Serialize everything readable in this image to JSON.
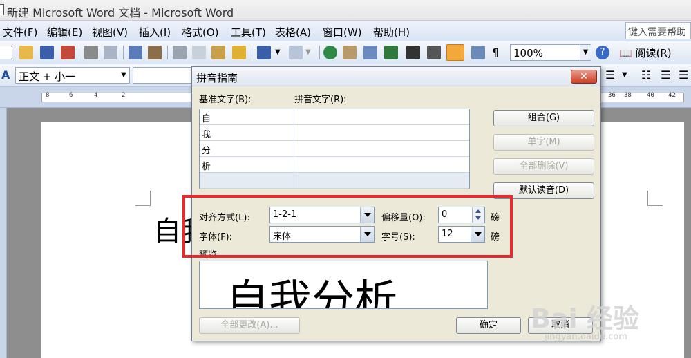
{
  "window": {
    "title": "新建 Microsoft Word 文档 - Microsoft Word"
  },
  "menubar": {
    "items": [
      "文件(F)",
      "编辑(E)",
      "视图(V)",
      "插入(I)",
      "格式(O)",
      "工具(T)",
      "表格(A)",
      "窗口(W)",
      "帮助(H)"
    ],
    "help_placeholder": "键入需要帮助"
  },
  "toolbar": {
    "zoom": "100%",
    "read_label": "阅读(R)"
  },
  "format_toolbar": {
    "style": "正文 + 小一"
  },
  "ruler": {
    "numbers": [
      "8",
      "6",
      "4",
      "2",
      "36",
      "38",
      "40",
      "42"
    ]
  },
  "document": {
    "text": "自我"
  },
  "dialog": {
    "title": "拼音指南",
    "base_text_label": "基准文字(B):",
    "ruby_text_label": "拼音文字(R):",
    "rows": [
      {
        "base": "自",
        "ruby": ""
      },
      {
        "base": "我",
        "ruby": ""
      },
      {
        "base": "分",
        "ruby": ""
      },
      {
        "base": "析",
        "ruby": ""
      },
      {
        "base": "",
        "ruby": ""
      }
    ],
    "buttons": {
      "group": "组合(G)",
      "mono": "单字(M)",
      "clear_all": "全部删除(V)",
      "default_reading": "默认读音(D)",
      "change_all": "全部更改(A)...",
      "ok": "确定",
      "cancel": "取消"
    },
    "alignment_label": "对齐方式(L):",
    "alignment_value": "1-2-1",
    "offset_label": "偏移量(O):",
    "offset_value": "0",
    "offset_unit": "磅",
    "font_label": "字体(F):",
    "font_value": "宋体",
    "size_label": "字号(S):",
    "size_value": "12",
    "size_unit": "磅",
    "preview_label": "预览",
    "preview_text": "自我分析"
  },
  "watermark": {
    "brand": "Bai 经验",
    "site": "jingyan.baidu.com"
  }
}
